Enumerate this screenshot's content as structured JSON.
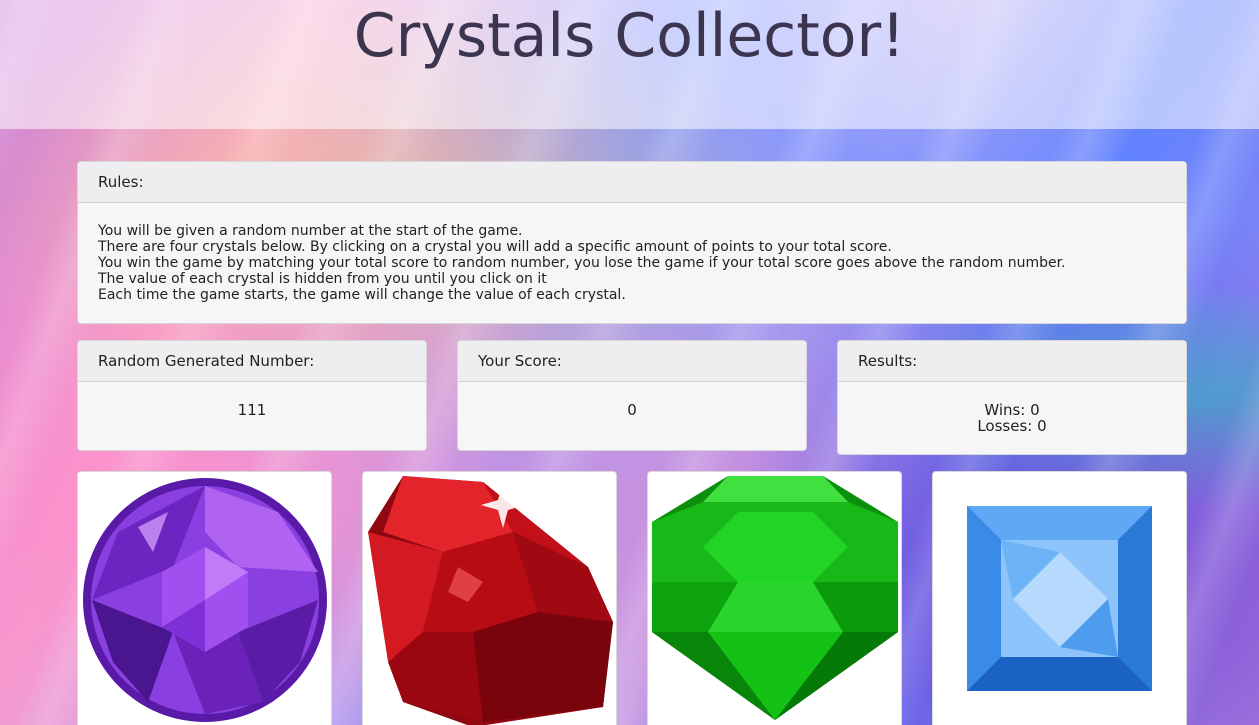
{
  "header": {
    "title": "Crystals Collector!"
  },
  "rules": {
    "heading": "Rules:",
    "lines": [
      "You will be given a random number at the start of the game.",
      "There are four crystals below. By clicking on a crystal you will add a specific amount of points to your total score.",
      "You win the game by matching your total score to random number, you lose the game if your total score goes above the random number.",
      "The value of each crystal is hidden from you until you click on it",
      "Each time the game starts, the game will change the value of each crystal."
    ]
  },
  "random_number": {
    "heading": "Random Generated Number:",
    "value": "111"
  },
  "score": {
    "heading": "Your Score:",
    "value": "0"
  },
  "results": {
    "heading": "Results:",
    "wins": "Wins: 0",
    "losses": "Losses: 0"
  },
  "crystals": [
    {
      "icon": "purple-round-gem-icon",
      "color": "#7a2fd0"
    },
    {
      "icon": "red-ruby-gem-icon",
      "color": "#c8101a"
    },
    {
      "icon": "green-emerald-gem-icon",
      "color": "#19c31a"
    },
    {
      "icon": "blue-square-gem-icon",
      "color": "#2f86e0"
    }
  ]
}
